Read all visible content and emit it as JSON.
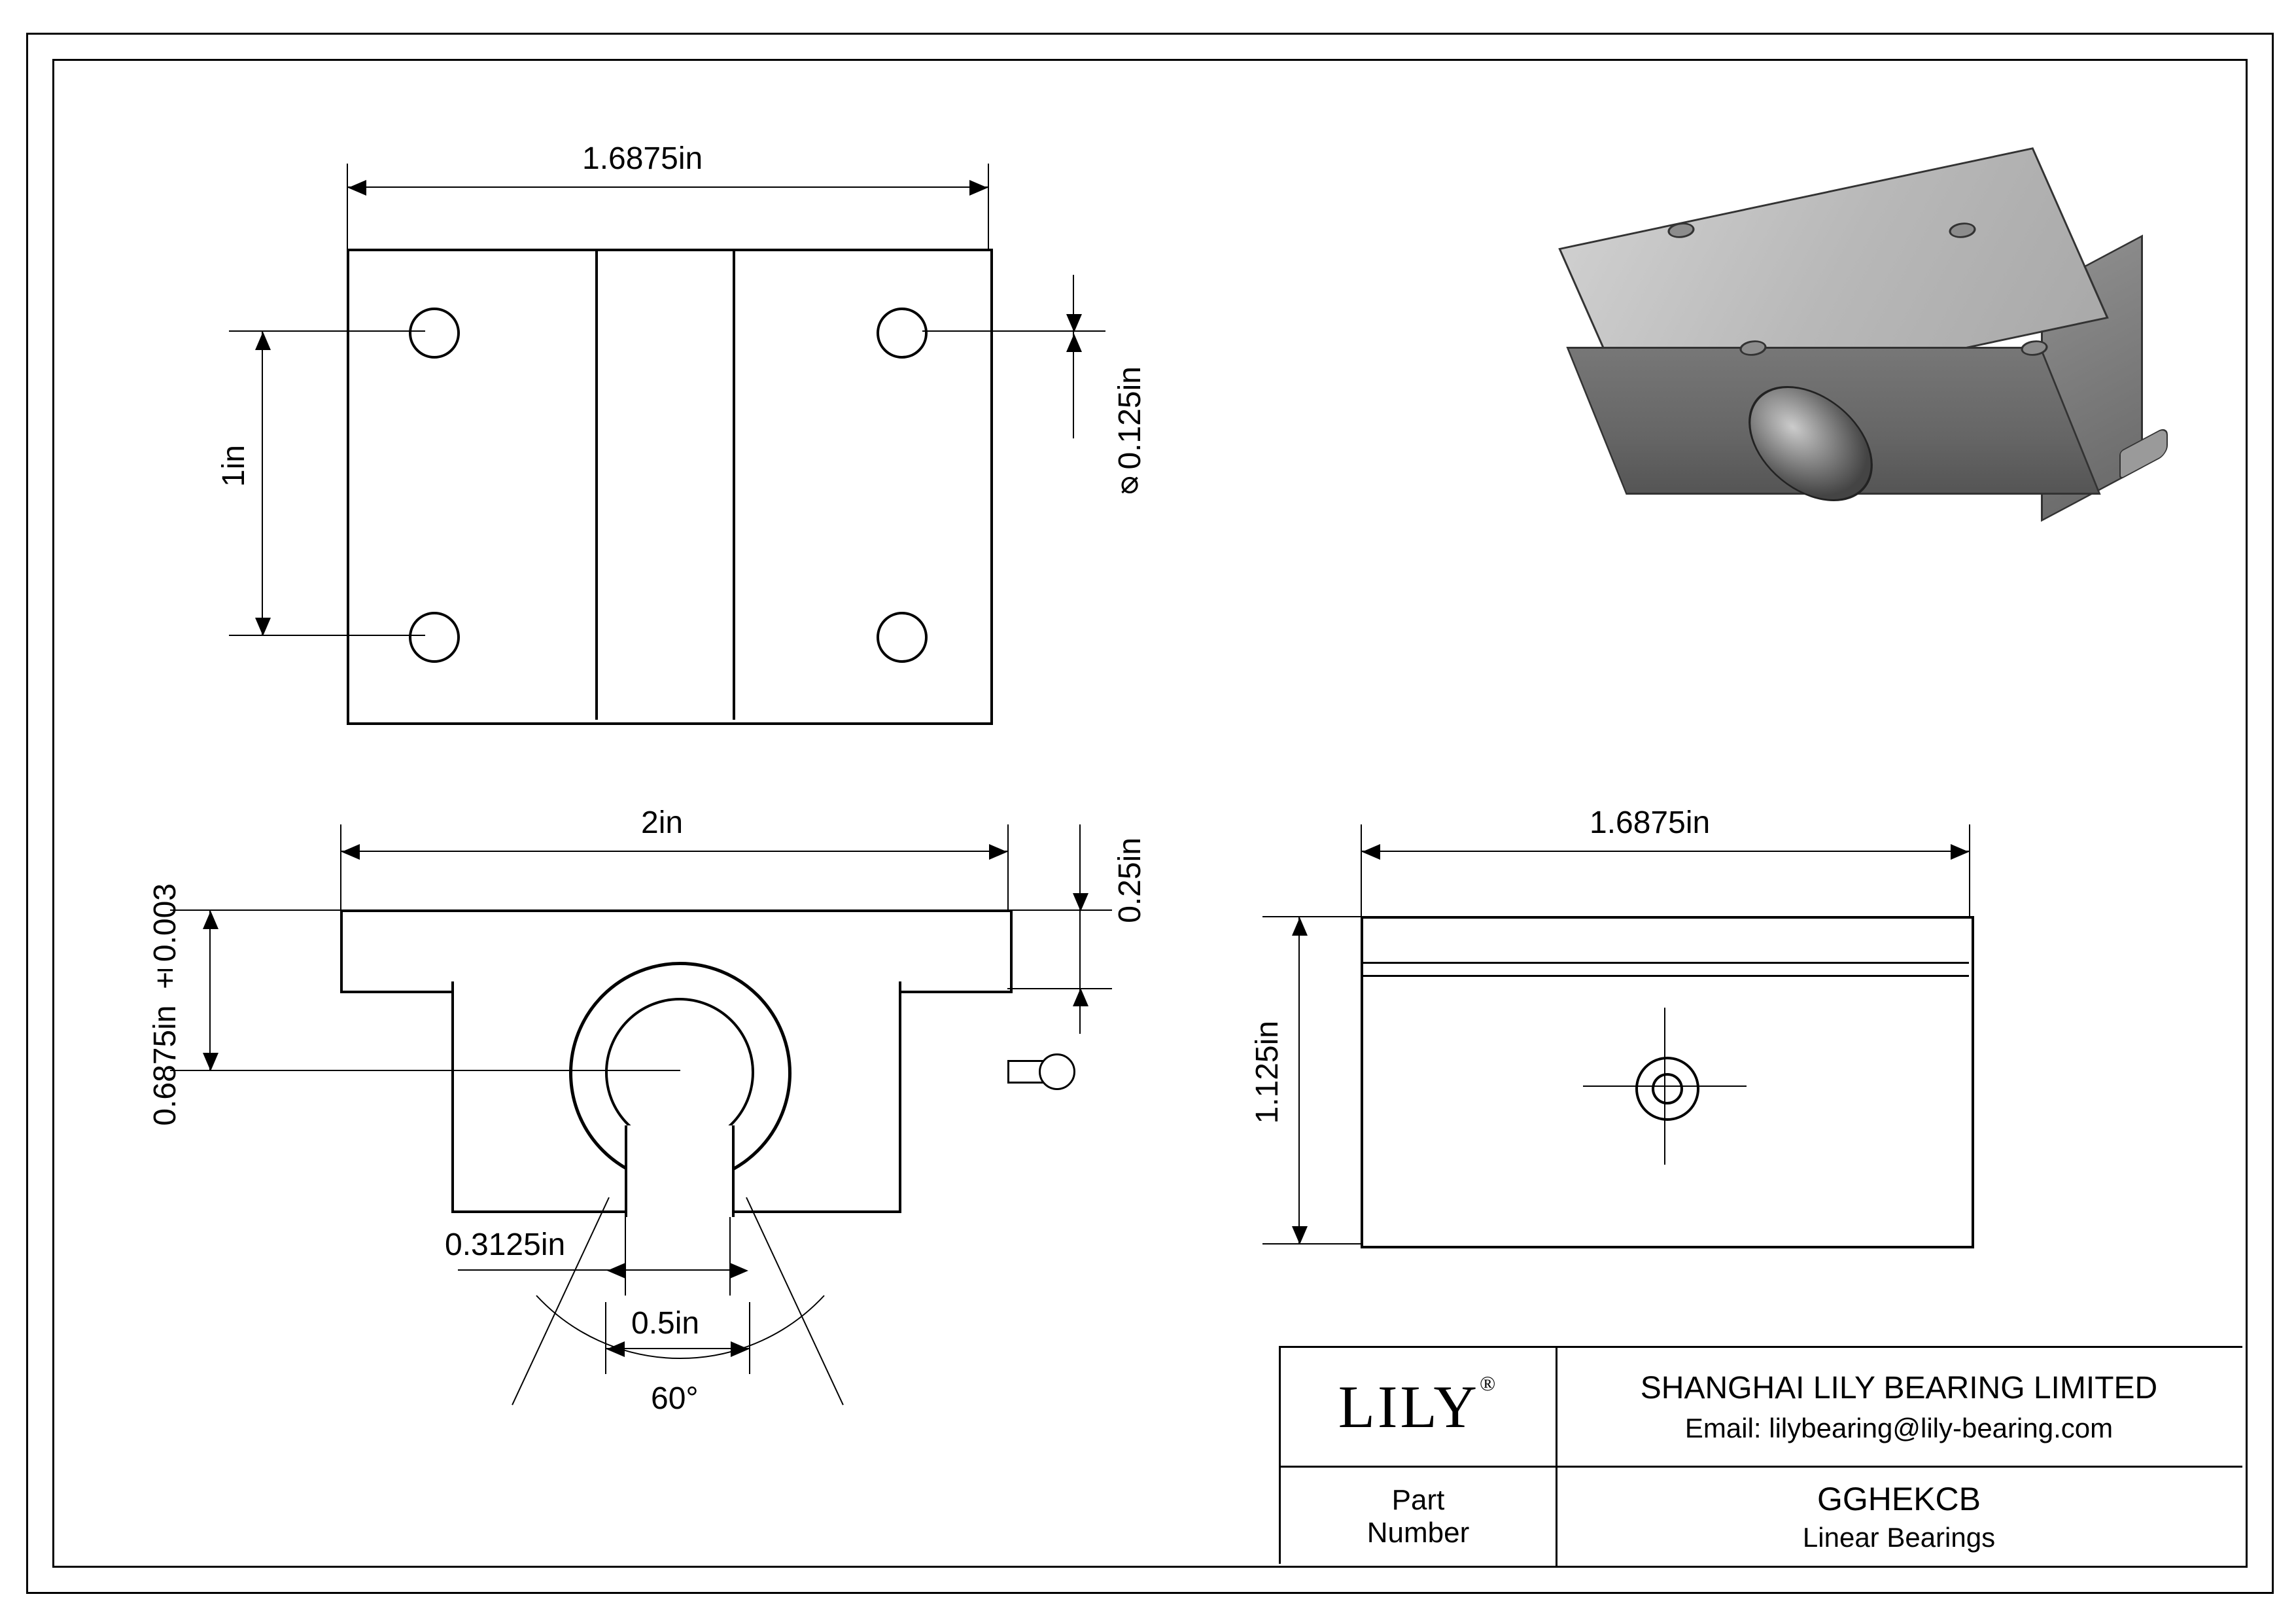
{
  "dims": {
    "top_width": "1.6875in",
    "hole_pitch_v": "1in",
    "hole_dia": "⌀0.125in",
    "overall_width": "2in",
    "flange_thk": "0.25in",
    "center_height": "0.6875in ±0.003",
    "slot_width": "0.3125in",
    "bore": "0.5in",
    "angle": "60°",
    "side_width": "1.6875in",
    "side_height": "1.125in"
  },
  "title_block": {
    "logo": "LILY",
    "logo_mark": "®",
    "company": "SHANGHAI LILY BEARING LIMITED",
    "email": "Email: lilybearing@lily-bearing.com",
    "pn_label_1": "Part",
    "pn_label_2": "Number",
    "part_number": "GGHEKCB",
    "description": "Linear Bearings"
  }
}
